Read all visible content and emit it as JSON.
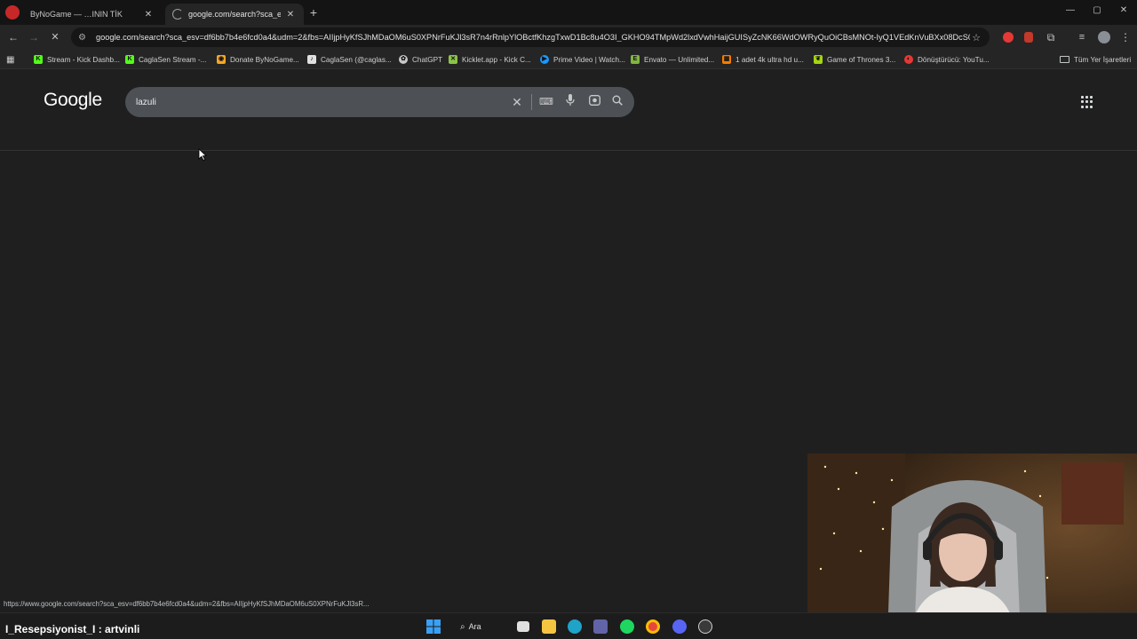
{
  "window": {
    "tabs": [
      {
        "title": "ByNoGame — …ININ TİK",
        "active": false,
        "favicon_color": "#e53935"
      },
      {
        "title": "google.com/search?sca_esv=df",
        "active": true,
        "favicon_color": "#9aa0a6"
      }
    ],
    "controls": {
      "minimize": "—",
      "maximize": "▢",
      "close": "✕"
    }
  },
  "toolbar": {
    "back": "←",
    "forward": "→",
    "reload": "↻",
    "url": "google.com/search?sca_esv=df6bb7b4e6fcd0a4&udm=2&fbs=AIIjpHyKfSJhMDaOM6uS0XPNrFuKJl3sR7n4rRnlpYlOBctfKhzgTxwD1Bc8u4O3I_GKHO94TMpWd2lxdVwhHaijGUISyZcNK66WdOWRyQuOiCBsMNOt-IyQ1VEdKnVuBXx08DcS0Q...",
    "star": "☆"
  },
  "bookmarks": {
    "items": [
      {
        "label": "Stream - Kick Dashb...",
        "icon": "kick-icon",
        "color": "#53fc18",
        "glyph": "K"
      },
      {
        "label": "CaglaSen Stream -...",
        "icon": "kick-icon",
        "color": "#53fc18",
        "glyph": "K"
      },
      {
        "label": "Donate ByNoGame...",
        "icon": "donate-icon",
        "color": "#f5a623",
        "glyph": "◉"
      },
      {
        "label": "CaglaSen (@caglas...",
        "icon": "tiktok-icon",
        "color": "#e0e0e0",
        "glyph": "♪"
      },
      {
        "label": "ChatGPT",
        "icon": "chatgpt-icon",
        "color": "#c8c8c8",
        "glyph": "✿"
      },
      {
        "label": "Kicklet.app - Kick C...",
        "icon": "kicklet-icon",
        "color": "#8bc34a",
        "glyph": "✕"
      },
      {
        "label": "Prime Video | Watch...",
        "icon": "prime-icon",
        "color": "#1a98ff",
        "glyph": "▶"
      },
      {
        "label": "Envato — Unlimited...",
        "icon": "envato-icon",
        "color": "#82b541",
        "glyph": "E"
      },
      {
        "label": "1 adet 4k ultra hd u...",
        "icon": "shop-icon",
        "color": "#f57c00",
        "glyph": "▦"
      },
      {
        "label": "Game of Thrones 3...",
        "icon": "leaf-icon",
        "color": "#a5d610",
        "glyph": "❦"
      },
      {
        "label": "Dönüştürücü: YouTu...",
        "icon": "converter-icon",
        "color": "#e53935",
        "glyph": "◐"
      }
    ],
    "all_bookmarks": "Tüm Yer İşaretleri"
  },
  "google": {
    "logo": "Google",
    "search_value": "lazuli",
    "search_placeholder": ""
  },
  "statusbar": {
    "text": "https://www.google.com/search?sca_esv=df6bb7b4e6fcd0a4&udm=2&fbs=AIIjpHyKfSJhMDaOM6uS0XPNrFuKJl3sR..."
  },
  "taskbar": {
    "stream_label": "I_Resepsiyonist_I : artvinli",
    "search_label": "Ara"
  }
}
